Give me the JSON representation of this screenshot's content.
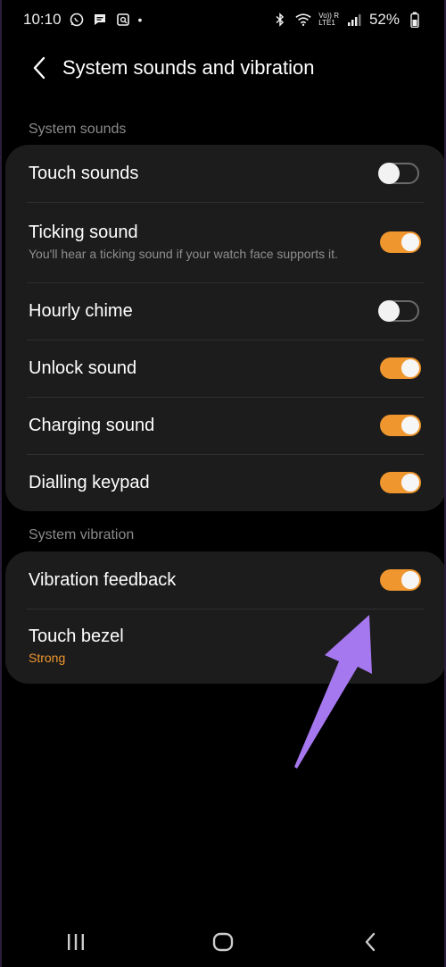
{
  "status_bar": {
    "time": "10:10",
    "left_icons": [
      "whatsapp-icon",
      "message-icon",
      "gallery-icon"
    ],
    "dot": "•",
    "network_label_top": "Vo)) R",
    "network_label_bottom": "LTE1",
    "battery": "52%"
  },
  "header": {
    "title": "System sounds and vibration"
  },
  "system_sounds": {
    "label": "System sounds",
    "items": [
      {
        "title": "Touch sounds",
        "subtitle": "",
        "on": false
      },
      {
        "title": "Ticking sound",
        "subtitle": "You'll hear a ticking sound if your watch face supports it.",
        "on": true
      },
      {
        "title": "Hourly chime",
        "subtitle": "",
        "on": false
      },
      {
        "title": "Unlock sound",
        "subtitle": "",
        "on": true
      },
      {
        "title": "Charging sound",
        "subtitle": "",
        "on": true
      },
      {
        "title": "Dialling keypad",
        "subtitle": "",
        "on": true
      }
    ]
  },
  "system_vibration": {
    "label": "System vibration",
    "items": [
      {
        "title": "Vibration feedback",
        "on": true
      },
      {
        "title": "Touch bezel",
        "subtitle": "Strong"
      }
    ]
  },
  "colors": {
    "accent": "#f0962e",
    "annotation_arrow": "#a678f0",
    "card_bg": "#1c1c1c"
  },
  "nav": [
    "recents-icon",
    "home-icon",
    "back-icon"
  ]
}
